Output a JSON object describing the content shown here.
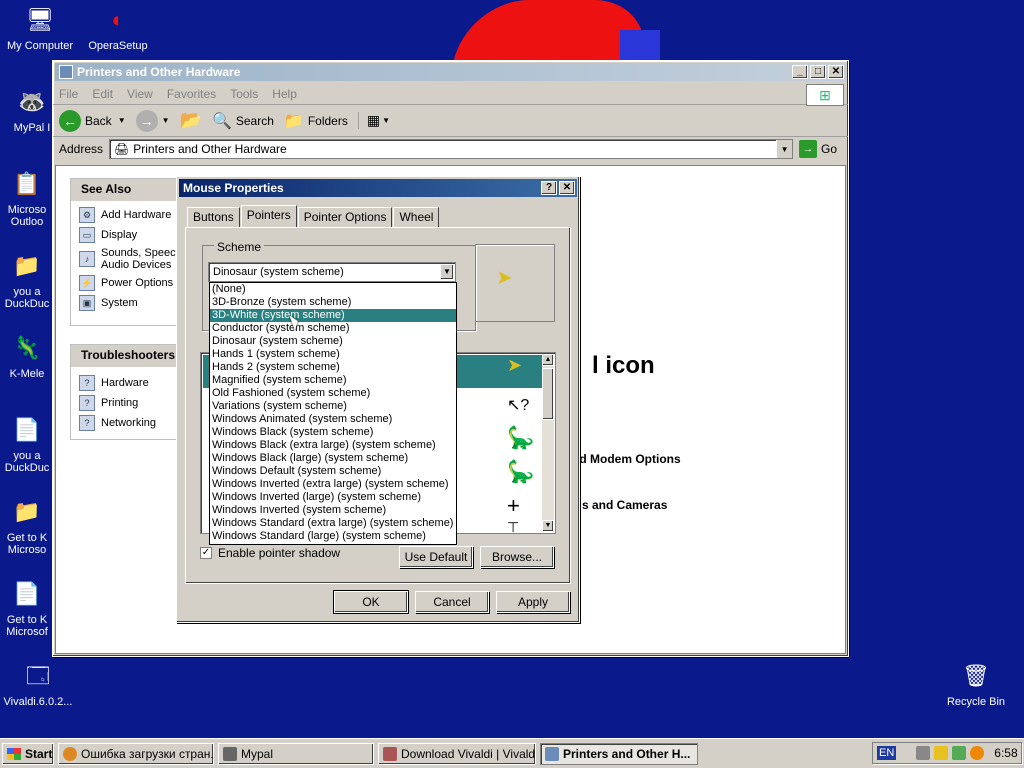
{
  "desktop": {
    "icons": [
      {
        "label": "My Computer"
      },
      {
        "label": "OperaSetup"
      },
      {
        "label": "MyPal I"
      },
      {
        "label": "Microso Outloo"
      },
      {
        "label": "you a DuckDuc"
      },
      {
        "label": "K-Mele"
      },
      {
        "label": "you a DuckDuc"
      },
      {
        "label": "Get to K Microso"
      },
      {
        "label": "Get to K Microsof"
      },
      {
        "label": "Vivaldi.6.0.2..."
      },
      {
        "label": "Recycle Bin"
      }
    ]
  },
  "explorer": {
    "title": "Printers and Other Hardware",
    "menu": [
      "File",
      "Edit",
      "View",
      "Favorites",
      "Tools",
      "Help"
    ],
    "toolbar": {
      "back": "Back",
      "search": "Search",
      "folders": "Folders"
    },
    "address": {
      "label": "Address",
      "value": "Printers and Other Hardware",
      "go": "Go"
    },
    "see_also": {
      "title": "See Also",
      "items": [
        "Add Hardware",
        "Display",
        "Sounds, Speec Audio Devices",
        "Power Options",
        "System"
      ]
    },
    "troubleshooters": {
      "title": "Troubleshooters",
      "items": [
        "Hardware",
        "Printing",
        "Networking"
      ]
    },
    "partial_text": {
      "icon_heading": "l icon",
      "modem": "nd Modem Options",
      "cameras": "s and Cameras"
    }
  },
  "dialog": {
    "title": "Mouse Properties",
    "tabs": [
      "Buttons",
      "Pointers",
      "Pointer Options",
      "Wheel"
    ],
    "selected_tab": "Pointers",
    "scheme_label": "Scheme",
    "scheme_value": "Dinosaur (system scheme)",
    "customize_label": "C",
    "enable_shadow": "Enable pointer shadow",
    "use_default": "Use Default",
    "browse": "Browse...",
    "ok": "OK",
    "cancel": "Cancel",
    "apply": "Apply",
    "dropdown_items": [
      "(None)",
      "3D-Bronze (system scheme)",
      "3D-White (system scheme)",
      "Conductor (system scheme)",
      "Dinosaur (system scheme)",
      "Hands 1 (system scheme)",
      "Hands 2 (system scheme)",
      "Magnified (system scheme)",
      "Old Fashioned (system scheme)",
      "Variations (system scheme)",
      "Windows Animated (system scheme)",
      "Windows Black  (system scheme)",
      "Windows Black (extra large) (system scheme)",
      "Windows Black (large) (system scheme)",
      "Windows Default (system scheme)",
      "Windows Inverted (extra large) (system scheme)",
      "Windows Inverted (large) (system scheme)",
      "Windows Inverted (system scheme)",
      "Windows Standard (extra large) (system scheme)",
      "Windows Standard (large) (system scheme)"
    ],
    "highlighted_index": 2,
    "cursor_glyphs": [
      "↖",
      "↖?",
      "🦕",
      "🦕",
      "+",
      "I"
    ]
  },
  "taskbar": {
    "start": "Start",
    "tasks": [
      {
        "label": "Ошибка загрузки стран..."
      },
      {
        "label": "Mypal"
      },
      {
        "label": "Download Vivaldi | Vivaldi..."
      },
      {
        "label": "Printers and Other H..."
      }
    ],
    "lang": "EN",
    "clock": "6:58"
  }
}
